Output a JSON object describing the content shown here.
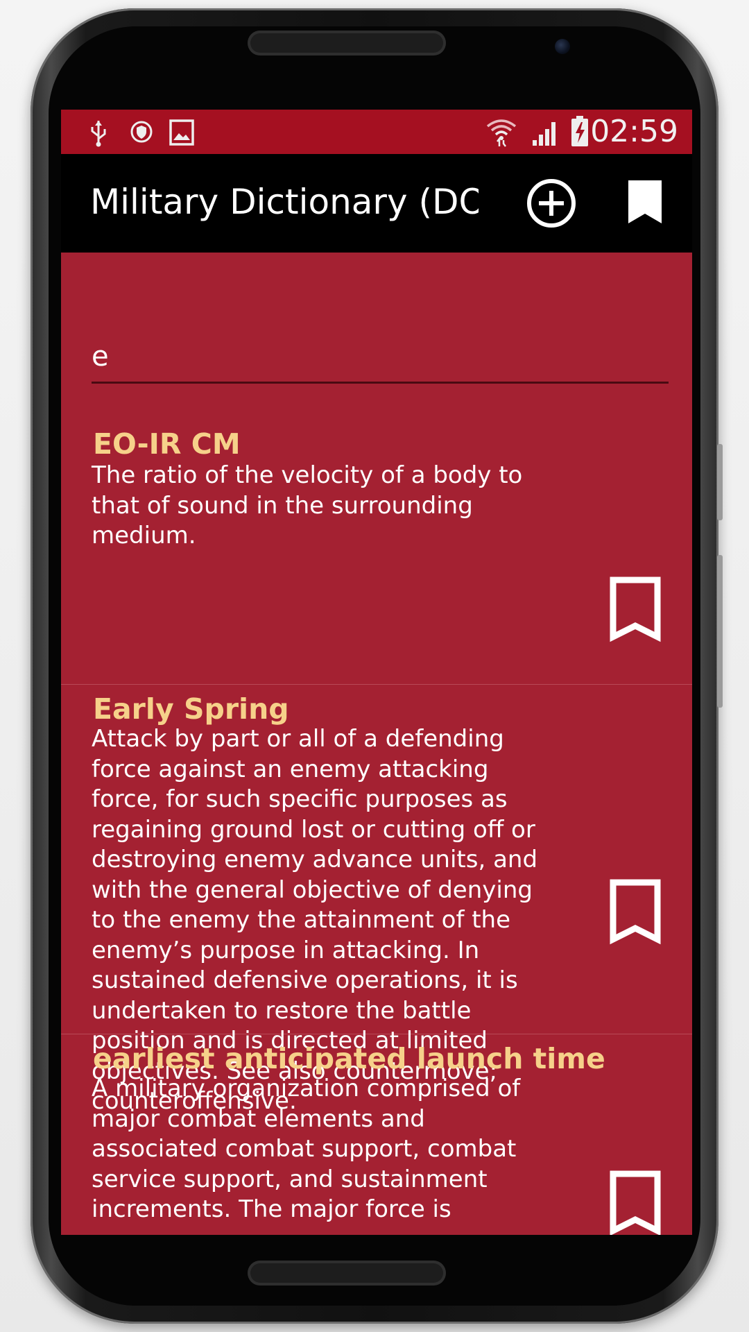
{
  "status_bar": {
    "time": "02:59",
    "left_icons": [
      "usb-icon",
      "shield-icon",
      "image-icon"
    ],
    "right_icons": [
      "wifi-icon",
      "signal-icon",
      "battery-charging-icon"
    ]
  },
  "toolbar": {
    "title": "Military Dictionary (DO...",
    "add_icon": "add-circle-icon",
    "bookmarks_icon": "bookmark-filled-icon"
  },
  "search": {
    "value": "e"
  },
  "entries": [
    {
      "term": "EO-IR CM",
      "definition": [
        "The ratio of the velocity of a body to",
        "that of sound in the surrounding",
        "medium."
      ]
    },
    {
      "term": "Early Spring",
      "definition": [
        "Attack by part or all of a defending",
        "force against an enemy attacking",
        "force, for such specific purposes as",
        "regaining ground lost or cutting off or",
        "destroying enemy advance units, and",
        "with the general objective of denying",
        "to the enemy the attainment of the",
        "enemy’s purpose in attacking.  In",
        "sustained defensive operations, it is",
        "undertaken to restore the battle",
        "position and is directed at limited",
        "objectives.  See also countermove;",
        "counteroffensive."
      ]
    },
    {
      "term": "earliest anticipated launch time",
      "definition": [
        "A military organization comprised of",
        "major combat elements and",
        "associated combat support, combat",
        "service support, and sustainment",
        "increments.  The major force is"
      ]
    }
  ],
  "colors": {
    "screen_bg": "#a42132",
    "status_bar_bg": "#a51021",
    "toolbar_bg": "#000000",
    "term_color": "#f6d18a",
    "definition_color": "#ffffff"
  }
}
